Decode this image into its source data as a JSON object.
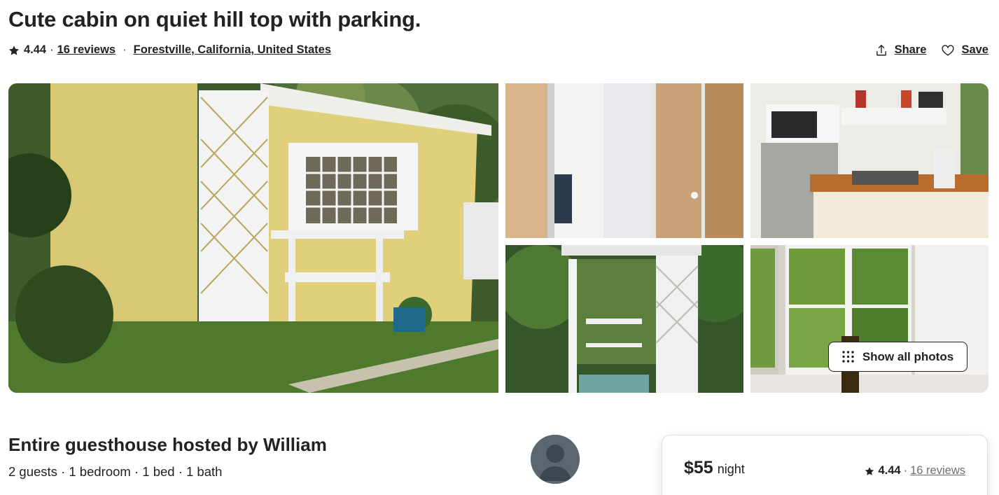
{
  "listing": {
    "title": "Cute cabin on quiet hill top with parking.",
    "rating": "4.44",
    "rating_separator": "·",
    "reviews_link": "16 reviews",
    "location_separator": "·",
    "location": "Forestville, California, United States"
  },
  "actions": {
    "share_label": "Share",
    "save_label": "Save"
  },
  "gallery": {
    "show_all_label": "Show all photos"
  },
  "host": {
    "title": "Entire guesthouse hosted by William",
    "details": "2 guests · 1 bedroom · 1 bed · 1 bath"
  },
  "booking": {
    "price": "$55",
    "price_unit": "night",
    "rating": "4.44",
    "rating_separator": "·",
    "reviews_link": "16 reviews"
  },
  "icons": {
    "star": "star-icon",
    "share": "share-icon",
    "save": "heart-icon",
    "grid": "grid-dots-icon",
    "avatar": "user-silhouette-icon"
  },
  "colors": {
    "text": "#222222",
    "muted": "#717171",
    "border": "#dddddd"
  }
}
